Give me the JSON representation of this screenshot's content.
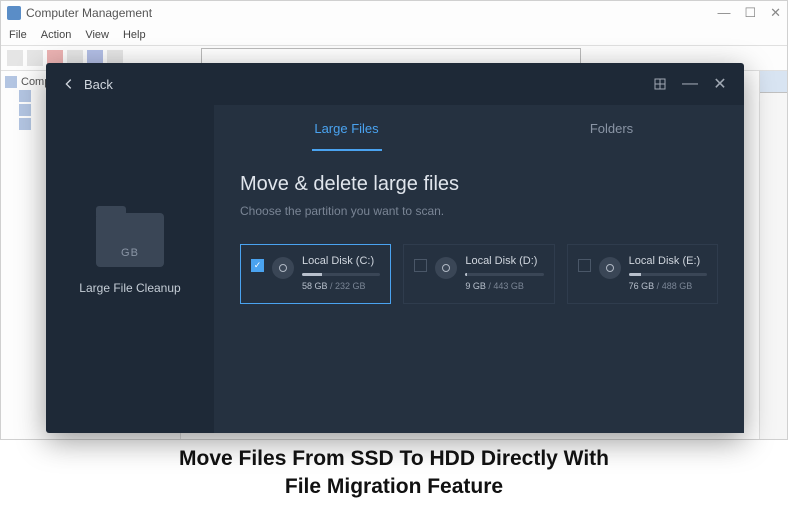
{
  "bg": {
    "title": "Computer Management",
    "menu": [
      "File",
      "Action",
      "View",
      "Help"
    ],
    "tree_root": "Computer Management (Local)"
  },
  "app": {
    "back": "Back",
    "sidebar": {
      "folder_badge": "GB",
      "label": "Large File Cleanup"
    },
    "tabs": [
      {
        "label": "Large Files",
        "active": true
      },
      {
        "label": "Folders",
        "active": false
      }
    ],
    "title": "Move & delete large files",
    "subtitle": "Choose the partition you want to scan.",
    "disks": [
      {
        "name": "Local Disk (C:)",
        "used": "58 GB",
        "total": "232 GB",
        "pct": 25,
        "selected": true
      },
      {
        "name": "Local Disk (D:)",
        "used": "9 GB",
        "total": "443 GB",
        "pct": 2,
        "selected": false
      },
      {
        "name": "Local Disk (E:)",
        "used": "76 GB",
        "total": "488 GB",
        "pct": 16,
        "selected": false
      }
    ]
  },
  "caption": {
    "line1": "Move Files From SSD To HDD Directly With",
    "line2": "File Migration Feature"
  }
}
